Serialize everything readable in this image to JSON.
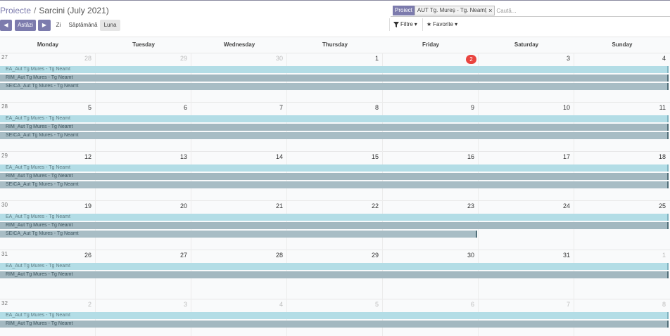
{
  "breadcrumb": {
    "parent": "Proiecte",
    "separator": "/",
    "current": "Sarcini (July 2021)"
  },
  "search": {
    "facet_label": "Proiect",
    "facet_value": "AUT Tg. Mureș - Tg. Neamț",
    "facet_close": "×",
    "placeholder": "Caută..."
  },
  "toolbar": {
    "prev": "◀",
    "today": "Astăzi",
    "next": "▶",
    "day": "Zi",
    "week": "Săptămână",
    "month": "Luna",
    "filters": "Filtre",
    "favorites": "Favorite"
  },
  "weekdays": [
    "Monday",
    "Tuesday",
    "Wednesday",
    "Thursday",
    "Friday",
    "Saturday",
    "Sunday"
  ],
  "weeks": [
    {
      "number": "27",
      "days": [
        "28",
        "29",
        "30",
        "1",
        "2",
        "3",
        "4"
      ],
      "muted": [
        true,
        true,
        true,
        false,
        false,
        false,
        false
      ],
      "events": [
        "EA_Aut Tg Mures - Tg Neamt",
        "RIM_Aut Tg Mures - Tg Neamt",
        "SEICA_Aut Tg Mures - Tg Neamt"
      ]
    },
    {
      "number": "28",
      "days": [
        "5",
        "6",
        "7",
        "8",
        "9",
        "10",
        "11"
      ],
      "muted": [
        false,
        false,
        false,
        false,
        false,
        false,
        false
      ],
      "events": [
        "EA_Aut Tg Mures - Tg Neamt",
        "RIM_Aut Tg Mures - Tg Neamt",
        "SEICA_Aut Tg Mures - Tg Neamt"
      ]
    },
    {
      "number": "29",
      "days": [
        "12",
        "13",
        "14",
        "15",
        "16",
        "17",
        "18"
      ],
      "muted": [
        false,
        false,
        false,
        false,
        false,
        false,
        false
      ],
      "events": [
        "EA_Aut Tg Mures - Tg Neamt",
        "RIM_Aut Tg Mures - Tg Neamt",
        "SEICA_Aut Tg Mures - Tg Neamt"
      ]
    },
    {
      "number": "30",
      "days": [
        "19",
        "20",
        "21",
        "22",
        "23",
        "24",
        "25"
      ],
      "muted": [
        false,
        false,
        false,
        false,
        false,
        false,
        false
      ],
      "events": [
        "EA_Aut Tg Mures - Tg Neamt",
        "RIM_Aut Tg Mures - Tg Neamt",
        "SEICA_Aut Tg Mures - Tg Neamt"
      ]
    },
    {
      "number": "31",
      "days": [
        "26",
        "27",
        "28",
        "29",
        "30",
        "31",
        "1"
      ],
      "muted": [
        false,
        false,
        false,
        false,
        false,
        false,
        true
      ],
      "events": [
        "EA_Aut Tg Mures - Tg Neamt",
        "RIM_Aut Tg Mures - Tg Neamt"
      ]
    },
    {
      "number": "32",
      "days": [
        "2",
        "3",
        "4",
        "5",
        "6",
        "7",
        "8"
      ],
      "muted": [
        true,
        true,
        true,
        true,
        true,
        true,
        true
      ],
      "events": [
        "EA_Aut Tg Mures - Tg Neamt",
        "RIM_Aut Tg Mures - Tg Neamt"
      ]
    }
  ],
  "today_day": "2",
  "colors": {
    "accent": "#7c7bad",
    "today": "#e9443f",
    "event_ea": "#b3dde6",
    "event_rim": "#a3b8c0"
  }
}
